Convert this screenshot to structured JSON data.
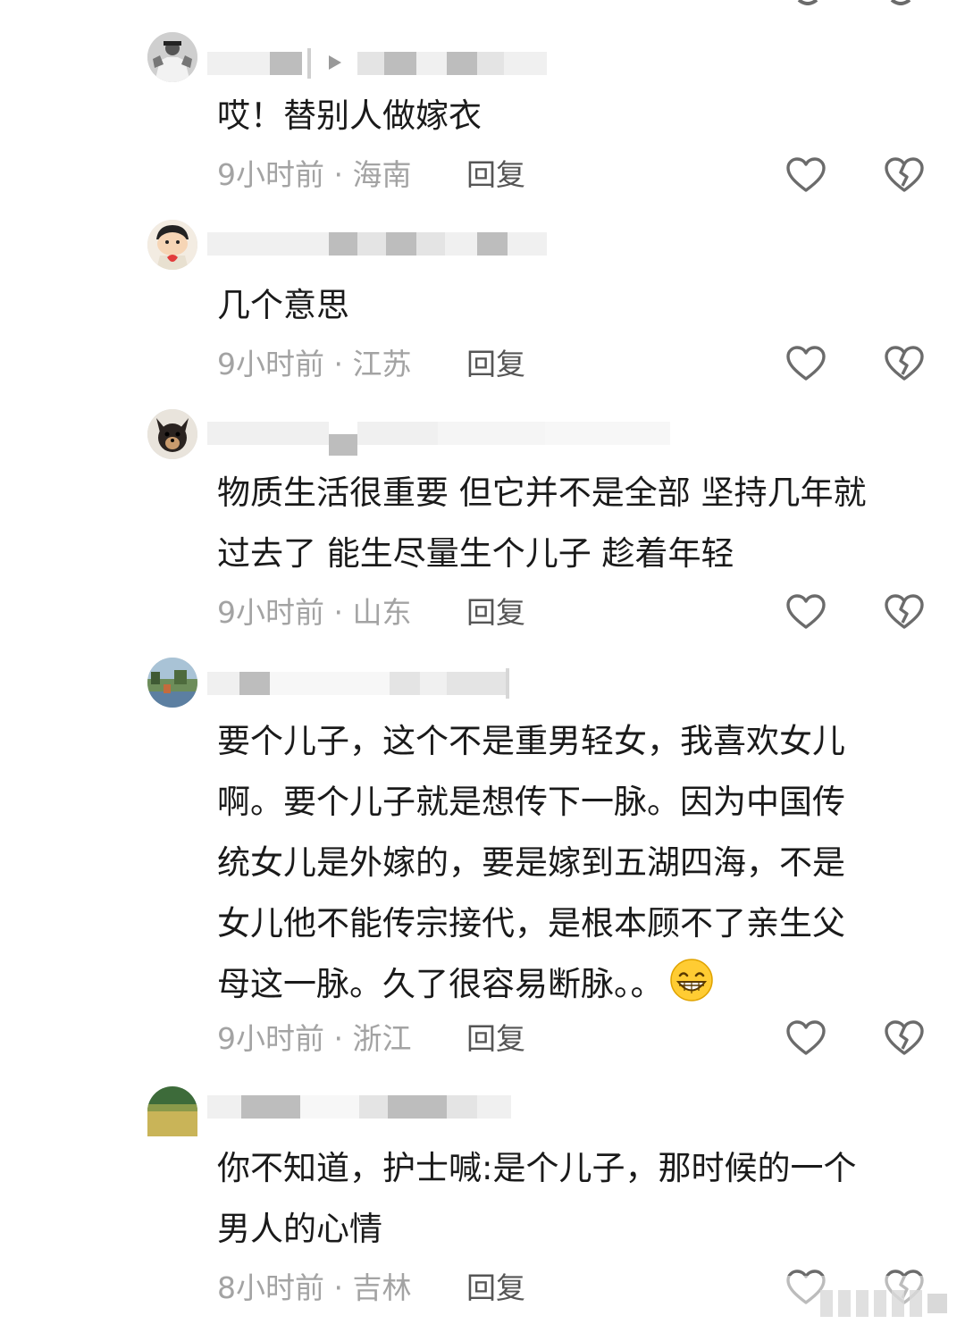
{
  "comments": [
    {
      "text": "哎！替别人做嫁衣",
      "time_location": "9小时前 · 海南",
      "reply_label": "回复",
      "avatar_icon": "avatar-person-bw"
    },
    {
      "text": "几个意思",
      "time_location": "9小时前 · 江苏",
      "reply_label": "回复",
      "avatar_icon": "avatar-cartoon-boy"
    },
    {
      "text": "物质生活很重要 但它并不是全部 坚持几年就\n过去了 能生尽量生个儿子 趁着年轻",
      "time_location": "9小时前 · 山东",
      "reply_label": "回复",
      "avatar_icon": "avatar-puppy"
    },
    {
      "text": "要个儿子，这个不是重男轻女，我喜欢女儿\n啊。要个儿子就是想传下一脉。因为中国传\n统女儿是外嫁的，要是嫁到五湖四海，不是\n女儿他不能传宗接代，是根本顾不了亲生父\n母这一脉。久了很容易断脉。。",
      "time_location": "9小时前 · 浙江",
      "reply_label": "回复",
      "avatar_icon": "avatar-scenery",
      "emoji": "grinning-face-emoji"
    },
    {
      "text": "你不知道，护士喊:是个儿子，那时候的一个\n男人的心情",
      "time_location": "8小时前 · 吉林",
      "reply_label": "回复",
      "avatar_icon": "avatar-green-yellow"
    }
  ],
  "colors": {
    "meta_text": "#a3a3a3",
    "reply_text": "#555555",
    "icon_stroke": "#6b6b6b",
    "body_text": "#1a1a1a"
  },
  "icons": {
    "like": "heart-outline-icon",
    "dislike": "broken-heart-outline-icon"
  }
}
